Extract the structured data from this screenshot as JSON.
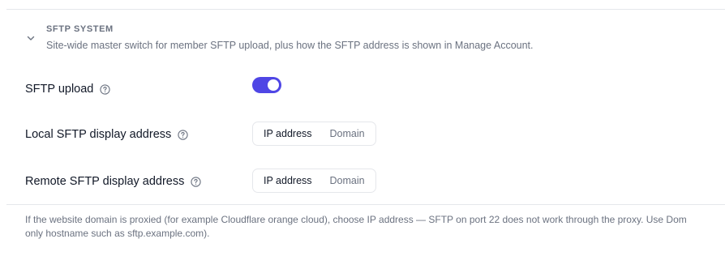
{
  "section": {
    "title": "SFTP SYSTEM",
    "description": "Site-wide master switch for member SFTP upload, plus how the SFTP address is shown in Manage Account."
  },
  "settings": {
    "sftp_upload": {
      "label": "SFTP upload",
      "enabled": true,
      "icon": "help-circle-icon"
    },
    "local_display": {
      "label": "Local SFTP display address",
      "icon": "help-circle-icon",
      "options": [
        "IP address",
        "Domain"
      ],
      "selected": "IP address"
    },
    "remote_display": {
      "label": "Remote SFTP display address",
      "icon": "help-circle-icon",
      "options": [
        "IP address",
        "Domain"
      ],
      "selected": "IP address"
    }
  },
  "footnote": {
    "line1": "If the website domain is proxied (for example Cloudflare orange cloud), choose IP address — SFTP on port 22 does not work through the proxy. Use Dom",
    "line2": "only hostname such as sftp.example.com)."
  },
  "colors": {
    "accent": "#4f46e5",
    "muted_text": "#6b7280",
    "border": "#e5e7eb"
  }
}
